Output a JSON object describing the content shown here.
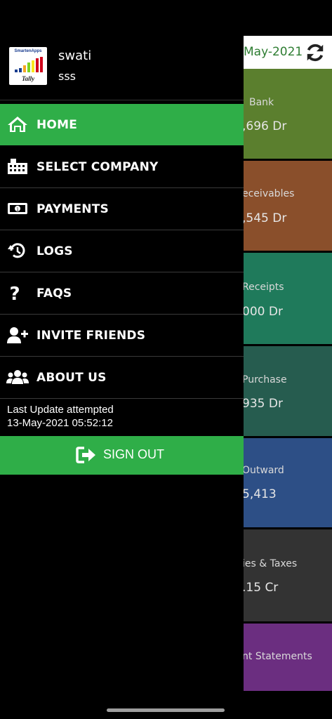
{
  "background": {
    "date_text": "May-2021",
    "refresh_icon": "sync-icon",
    "tiles": [
      {
        "label": "Bank",
        "value": ",696 Dr",
        "color": "#5b7f2e"
      },
      {
        "label": "eceivables",
        "value": ",545 Dr",
        "color": "#8a4f2b"
      },
      {
        "label": "Receipts",
        "value": "000 Dr",
        "color": "#1f7a5b"
      },
      {
        "label": "Purchase",
        "value": "935 Dr",
        "color": "#265c4f"
      },
      {
        "label": "Outward",
        "value": "5,413",
        "color": "#2d4f86"
      },
      {
        "label": "ies & Taxes",
        "value": ".15 Cr",
        "color": "#333333"
      },
      {
        "label": "nt Statements",
        "value": "",
        "color": "#6b2e80"
      }
    ]
  },
  "drawer": {
    "logo_text": "SmartenApps",
    "logo_subtext": "Tally",
    "user": {
      "name": "swati",
      "company": "sss"
    },
    "menu": [
      {
        "label": "HOME",
        "icon": "home-icon",
        "active": true
      },
      {
        "label": "SELECT COMPANY",
        "icon": "building-icon",
        "active": false
      },
      {
        "label": "PAYMENTS",
        "icon": "money-bill-icon",
        "active": false
      },
      {
        "label": "LOGS",
        "icon": "history-icon",
        "active": false
      },
      {
        "label": "FAQS",
        "icon": "question-icon",
        "active": false
      },
      {
        "label": "INVITE FRIENDS",
        "icon": "user-plus-icon",
        "active": false
      },
      {
        "label": "ABOUT US",
        "icon": "users-icon",
        "active": false
      }
    ],
    "last_update": {
      "line1": "Last Update attempted",
      "line2": "13-May-2021 05:52:12"
    },
    "signout": {
      "label": "SIGN OUT",
      "icon": "sign-out-icon"
    }
  },
  "colors": {
    "accent": "#2fae48",
    "drawer_bg": "#000000"
  }
}
